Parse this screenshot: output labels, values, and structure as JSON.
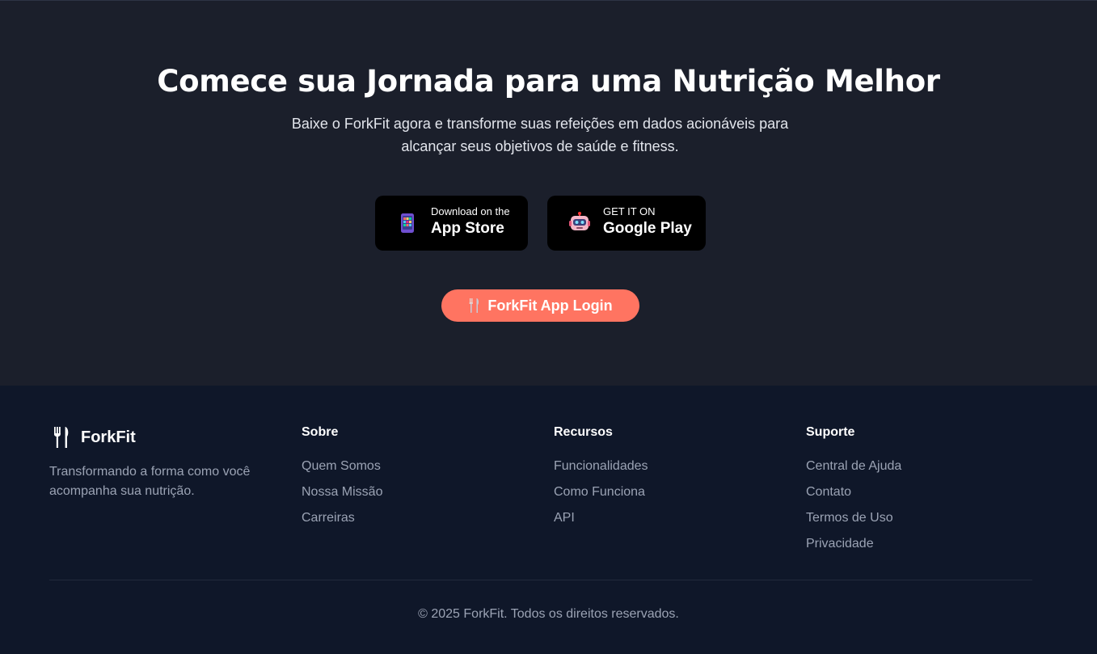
{
  "cta": {
    "title": "Comece sua Jornada para uma Nutrição Melhor",
    "subtitle": "Baixe o ForkFit agora e transforme suas refeições em dados acionáveis para alcançar seus objetivos de saúde e fitness.",
    "app_store": {
      "small": "Download on the",
      "big": "App Store",
      "icon": "mobile-phone-icon"
    },
    "google_play": {
      "small": "GET IT ON",
      "big": "Google Play",
      "icon": "robot-icon"
    },
    "login_button": {
      "label": "ForkFit App Login",
      "icon": "fork-knife-icon"
    },
    "colors": {
      "background": "#1b1f2b",
      "accent": "#ff7461"
    }
  },
  "footer": {
    "brand": {
      "name": "ForkFit",
      "icon": "fork-knife-icon",
      "description": "Transformando a forma como você acompanha sua nutrição."
    },
    "columns": [
      {
        "title": "Sobre",
        "links": [
          "Quem Somos",
          "Nossa Missão",
          "Carreiras"
        ]
      },
      {
        "title": "Recursos",
        "links": [
          "Funcionalidades",
          "Como Funciona",
          "API"
        ]
      },
      {
        "title": "Suporte",
        "links": [
          "Central de Ajuda",
          "Contato",
          "Termos de Uso",
          "Privacidade"
        ]
      }
    ],
    "copyright": "© 2025 ForkFit. Todos os direitos reservados.",
    "colors": {
      "background": "#0f1729",
      "muted_text": "#9ba3b4"
    }
  }
}
